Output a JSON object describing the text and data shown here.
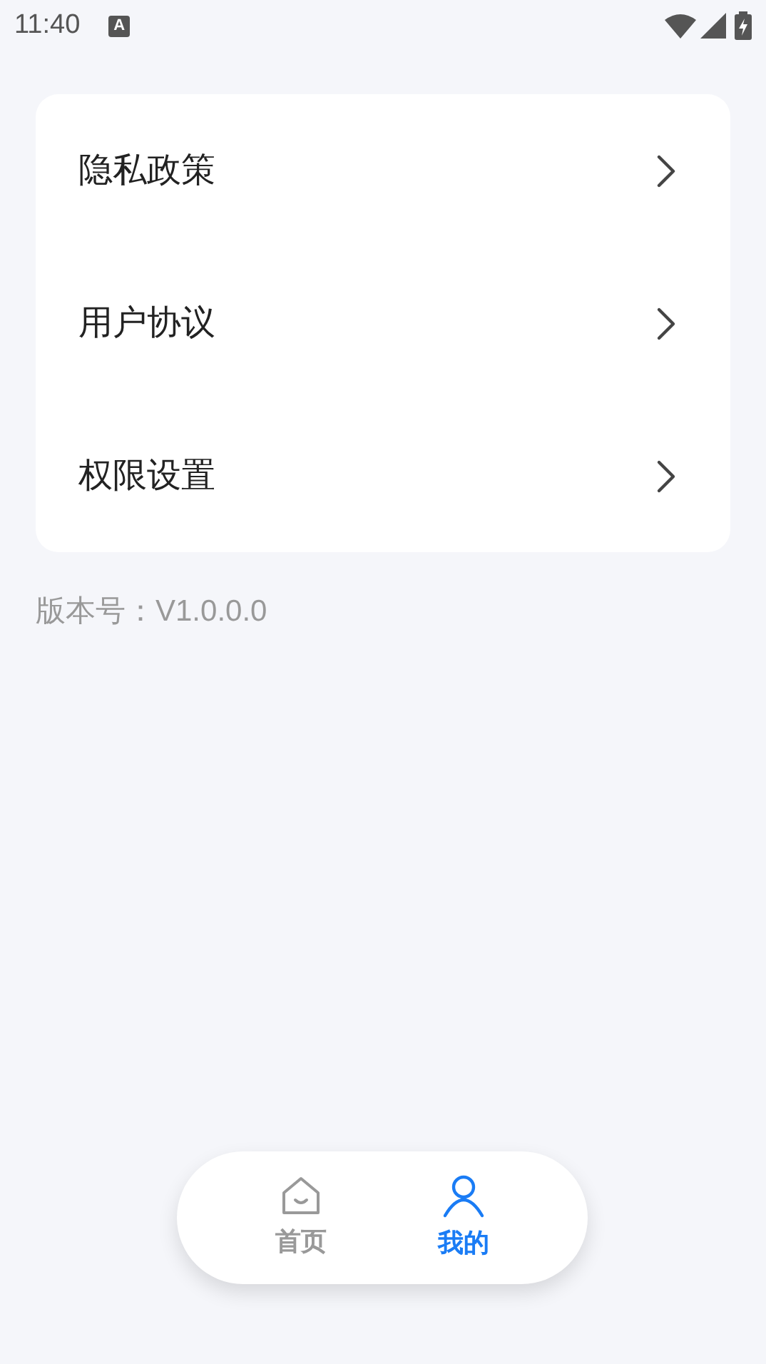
{
  "status_bar": {
    "time": "11:40",
    "notification_letter": "A"
  },
  "menu": [
    {
      "label": "隐私政策"
    },
    {
      "label": "用户协议"
    },
    {
      "label": "权限设置"
    }
  ],
  "version": "版本号：V1.0.0.0",
  "bottom_nav": [
    {
      "label": "首页",
      "kind": "home",
      "selected": false
    },
    {
      "label": "我的",
      "kind": "profile",
      "selected": true
    }
  ]
}
